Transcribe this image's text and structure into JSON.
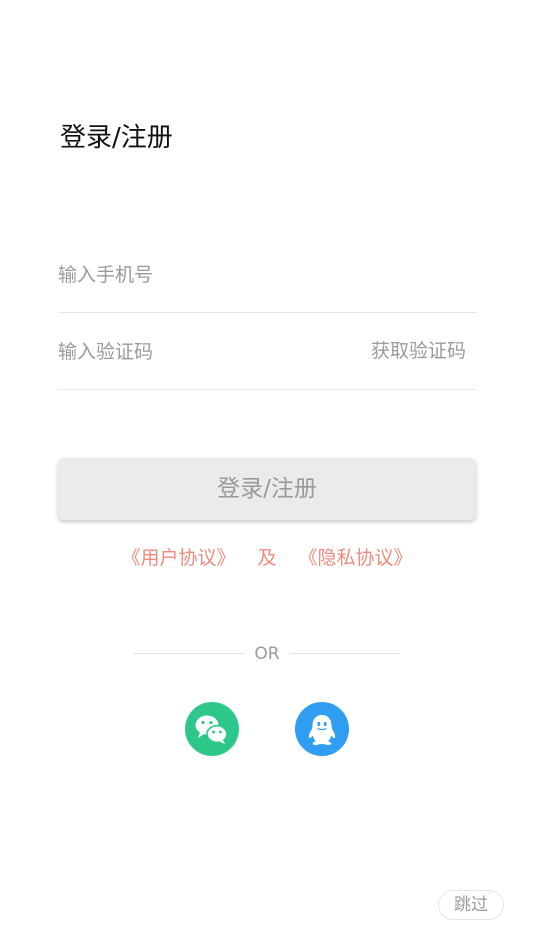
{
  "header": {
    "title": "登录/注册"
  },
  "form": {
    "phone": {
      "value": "",
      "placeholder": "输入手机号"
    },
    "code": {
      "value": "",
      "placeholder": "输入验证码",
      "get_code_label": "获取验证码"
    },
    "submit_label": "登录/注册"
  },
  "agreement": {
    "user_agreement": "《用户协议》",
    "connector": "及",
    "privacy_policy": "《隐私协议》",
    "color": "#f08a7e"
  },
  "divider": {
    "label": "OR"
  },
  "social_login": [
    {
      "icon": "wechat-icon",
      "color": "#2dc889"
    },
    {
      "icon": "qq-penguin-icon",
      "color": "#2f9df2"
    }
  ],
  "skip_label": "跳过"
}
